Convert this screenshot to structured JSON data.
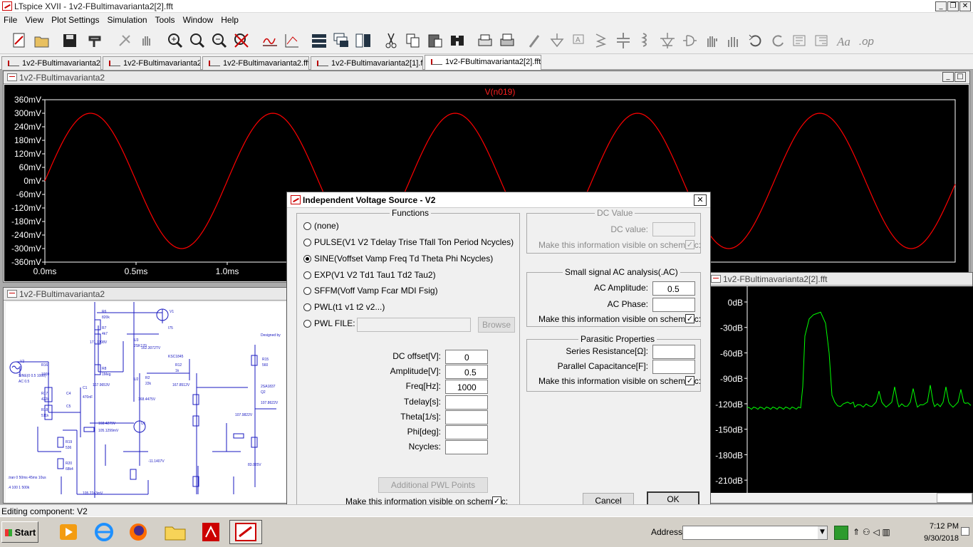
{
  "app": {
    "window_title": "LTspice XVII - 1v2-FBultimavarianta2[2].fft",
    "menu": [
      "File",
      "View",
      "Plot Settings",
      "Simulation",
      "Tools",
      "Window",
      "Help"
    ]
  },
  "toolbar": {
    "icons": [
      "new-schematic-icon",
      "open-folder-icon",
      "save-icon",
      "control-panel-hammer-icon",
      "run-icon",
      "pan-hand-icon",
      "zoom-in-icon",
      "zoom-full-icon",
      "zoom-out-icon",
      "zoom-cancel-icon",
      "autoscale-icon",
      "view-fft-icon",
      "tile-horizontal-icon",
      "cascade-icon",
      "tile-vertical-icon",
      "cut-icon",
      "copy-icon",
      "paste-icon",
      "find-binoculars-icon",
      "print-icon",
      "print-setup-icon",
      "draw-wire-icon",
      "ground-icon",
      "label-net-icon",
      "resistor-icon",
      "capacitor-icon",
      "inductor-icon",
      "diode-icon",
      "component-icon",
      "move-hand-icon",
      "drag-hand-icon",
      "undo-icon",
      "redo-icon",
      "rotate-icon",
      "mirror-icon",
      "text-icon",
      "spice-directive-icon"
    ],
    "colors": {
      "accent": "#c00000"
    }
  },
  "tabs": [
    {
      "label": "1v2-FBultimavarianta2"
    },
    {
      "label": "1v2-FBultimavarianta2"
    },
    {
      "label": "1v2-FBultimavarianta2.fft"
    },
    {
      "label": "1v2-FBultimavarianta2[1].fft"
    },
    {
      "label": "1v2-FBultimavarianta2[2].fft"
    }
  ],
  "waveform_window": {
    "title": "1v2-FBultimavarianta2",
    "trace_label": "V(n019)",
    "chart_data": {
      "type": "line",
      "series": [
        {
          "name": "V(n019)",
          "color": "#ff0000",
          "shape": "sine",
          "amplitude_mV": 300,
          "period_ms": 1.0
        }
      ],
      "xlabel": "",
      "ylabel": "",
      "yticks": [
        "360mV",
        "300mV",
        "240mV",
        "180mV",
        "120mV",
        "60mV",
        "0mV",
        "-60mV",
        "-120mV",
        "-180mV",
        "-240mV",
        "-300mV",
        "-360mV"
      ],
      "xticks": [
        "0.0ms",
        "0.5ms",
        "1.0ms"
      ],
      "ylim": [
        -360,
        360
      ],
      "grid": false
    }
  },
  "schematic_window": {
    "title": "1v2-FBultimavarianta2",
    "labels": {
      "r6": "R6",
      "r6_val": "820k",
      "r7": "R7",
      "r7_val": "4k7",
      "r8": "R8",
      "r8_val": "1Meg",
      "u3": "U3",
      "u3_part": "2SK170",
      "v1": "V1",
      "i75": "I75",
      "ksc": "KSC1845",
      "r12": "R12",
      "r12_val": "1k",
      "r15": "R15",
      "r15_val": "560",
      "q2": "Q2",
      "q2_part": "2SA1837",
      "r16": "R16",
      "r16_val": "1000",
      "v2": "V2",
      "v2_fn": "SINE(0 0.5 1000)",
      "v2_ac": "AC 0.5",
      "r17": "R17",
      "r17_val": "422k",
      "r18": "R18",
      "r18_val": "511k",
      "c4": "C4",
      "c5": "C5",
      "c1": "C1",
      "c1_val": "470nF",
      "r2": "R2",
      "r2_val": "22k",
      "u2": "U2",
      "u1": "U1",
      "r19": "R19",
      "r19_val": "536",
      "r20": "R20",
      "r20_val": "68k4",
      "cmd1": ".tran 0 50ms 45ms 10us",
      "cmd2": ".4 100 1 500k",
      "designed_by": "Designed by",
      "n1": "171.7708V",
      "n2": "162.3072TV",
      "n3": "167.9653V",
      "n4": "167.8512V",
      "n5": "168.4475V",
      "n6": "168.4279V",
      "n7": "105.1299mV",
      "n8": "105.2243mV",
      "n9": "107.9822V",
      "n10": "107.8622V",
      "n11": "-11.1407V",
      "n12": "83.025V"
    }
  },
  "fft_window": {
    "title": "1v2-FBultimavarianta2[2].fft",
    "chart_data": {
      "type": "line",
      "series": [
        {
          "name": "FFT",
          "color": "#00ff00"
        }
      ],
      "yticks": [
        "0dB",
        "-30dB",
        "-60dB",
        "-90dB",
        "-120dB",
        "-150dB",
        "-180dB",
        "-210dB"
      ],
      "ylim": [
        -225,
        0
      ],
      "noise_floor_dB": -125,
      "fundamental_peak_dB": -15,
      "harmonic_peaks_dB": [
        -120,
        -105,
        -100,
        -102,
        -98,
        -100,
        -103
      ],
      "grid": false
    }
  },
  "dialog": {
    "title": "Independent Voltage Source - V2",
    "functions_label": "Functions",
    "options": [
      {
        "label": "(none)",
        "selected": false
      },
      {
        "label": "PULSE(V1 V2 Tdelay Trise Tfall Ton Period Ncycles)",
        "selected": false
      },
      {
        "label": "SINE(Voffset Vamp Freq Td Theta Phi Ncycles)",
        "selected": true
      },
      {
        "label": "EXP(V1 V2 Td1 Tau1 Td2 Tau2)",
        "selected": false
      },
      {
        "label": "SFFM(Voff Vamp Fcar MDI Fsig)",
        "selected": false
      },
      {
        "label": "PWL(t1 v1 t2 v2...)",
        "selected": false
      },
      {
        "label": "PWL FILE:",
        "selected": false
      }
    ],
    "browse_label": "Browse",
    "pwl_file_value": "",
    "params": [
      {
        "label": "DC offset[V]:",
        "value": "0"
      },
      {
        "label": "Amplitude[V]:",
        "value": "0.5"
      },
      {
        "label": "Freq[Hz]:",
        "value": "1000"
      },
      {
        "label": "Tdelay[s]:",
        "value": ""
      },
      {
        "label": "Theta[1/s]:",
        "value": ""
      },
      {
        "label": "Phi[deg]:",
        "value": ""
      },
      {
        "label": "Ncycles:",
        "value": ""
      }
    ],
    "additional_pwl_label": "Additional PWL Points",
    "visible_label": "Make this information visible on schematic:",
    "visible_checked": true,
    "dc_value": {
      "group_label": "DC Value",
      "label": "DC value:",
      "value": "",
      "visible_label": "Make this information visible on schematic:",
      "visible_checked": true
    },
    "ac": {
      "group_label": "Small signal AC analysis(.AC)",
      "amplitude_label": "AC Amplitude:",
      "amplitude_value": "0.5",
      "phase_label": "AC Phase:",
      "phase_value": "",
      "visible_label": "Make this information visible on schematic:",
      "visible_checked": true
    },
    "parasitic": {
      "group_label": "Parasitic Properties",
      "series_label": "Series Resistance[Ω]:",
      "series_value": "",
      "parallel_label": "Parallel Capacitance[F]:",
      "parallel_value": "",
      "visible_label": "Make this information visible on schematic:",
      "visible_checked": true
    },
    "cancel_label": "Cancel",
    "ok_label": "OK",
    "close_glyph": "✕"
  },
  "status": {
    "text": "Editing component: V2"
  },
  "taskbar": {
    "start_label": "Start",
    "apps": [
      "media-player-icon",
      "internet-explorer-icon",
      "firefox-icon",
      "file-explorer-icon",
      "pdf-reader-icon",
      "ltspice-icon"
    ],
    "address_label": "Address",
    "address_value": "",
    "time": "7:12 PM",
    "date": "9/30/2018"
  }
}
